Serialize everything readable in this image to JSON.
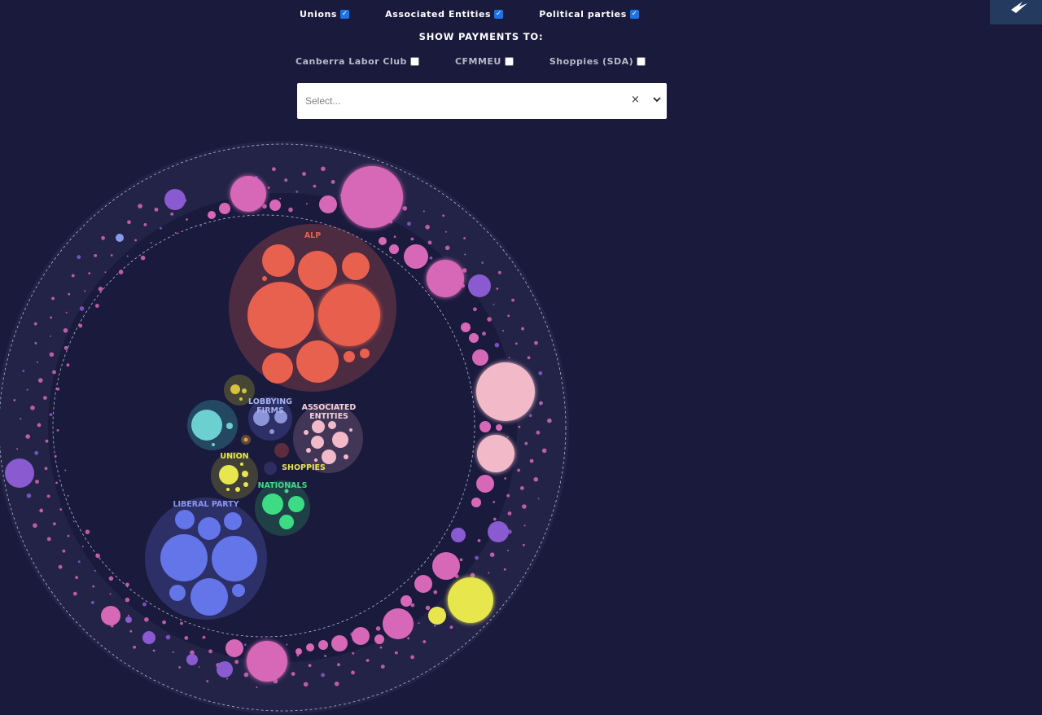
{
  "filters": [
    {
      "label": "Unions",
      "checked": true
    },
    {
      "label": "Associated Entities",
      "checked": true
    },
    {
      "label": "Political parties",
      "checked": true
    }
  ],
  "show_payments_title": "SHOW PAYMENTS TO:",
  "payments": [
    {
      "label": "Canberra Labor Club",
      "checked": false
    },
    {
      "label": "CFMMEU",
      "checked": false
    },
    {
      "label": "Shoppies (SDA)",
      "checked": false
    }
  ],
  "select": {
    "placeholder": "Select...",
    "clear_glyph": "×"
  },
  "logo": {
    "icon": "logo-icon"
  },
  "groups": {
    "alp": {
      "label": "ALP",
      "color": "#e8604e"
    },
    "lobbying": {
      "label_line1": "LOBBYING",
      "label_line2": "FIRMS",
      "color": "#8b95d8"
    },
    "associated": {
      "label_line1": "ASSOCIATED",
      "label_line2": "ENTITIES",
      "color": "#f2b9c9"
    },
    "union": {
      "label": "UNION",
      "color": "#e8e64e"
    },
    "shoppies": {
      "label": "SHOPPIES",
      "color": "#e8e64e"
    },
    "nationals": {
      "label": "NATIONALS",
      "color": "#3ddc84"
    },
    "liberal": {
      "label": "LIBERAL PARTY",
      "color": "#6375e8"
    }
  },
  "colors": {
    "background": "#1a1a3d",
    "ring": "#232347",
    "donor_pink": "#d768b8",
    "donor_purple": "#8a5ad0",
    "donor_light": "#f2b9c9",
    "donor_yellow": "#e8e64e",
    "checkbox": "#1a73e8"
  }
}
